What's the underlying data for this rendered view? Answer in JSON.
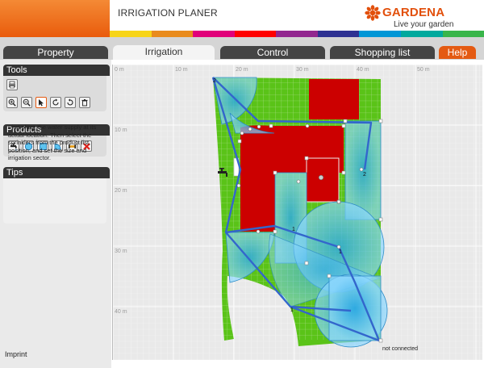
{
  "header": {
    "app_title": "IRRIGATION PLANER",
    "brand_name": "GARDENA",
    "brand_tagline": "Live your garden",
    "brand_color": "#e2500c",
    "strip_colors": [
      "#f7d417",
      "#e98b1d",
      "#e1007a",
      "#ff0000",
      "#92278f",
      "#2e3192",
      "#0096d6",
      "#00a99d",
      "#39b54a"
    ]
  },
  "tabs": [
    {
      "label": "Property",
      "active": false
    },
    {
      "label": "Irrigation",
      "active": true
    },
    {
      "label": "Control",
      "active": false
    },
    {
      "label": "Shopping list",
      "active": false
    },
    {
      "label": "Help",
      "active": false
    }
  ],
  "tools": {
    "title": "Tools",
    "items": [
      "print-icon",
      "zoom-in-icon",
      "zoom-out-icon",
      "pointer-icon",
      "rotate-left-icon",
      "rotate-right-icon",
      "trash-icon"
    ]
  },
  "products": {
    "title": "Products",
    "items": [
      "water-tap-icon",
      "circle-sprinkler-icon",
      "square-sprinkler-icon",
      "sector-sprinkler-icon",
      "pipe-connector-icon",
      "delete-icon"
    ]
  },
  "tips": {
    "title": "Tips",
    "text": "First place the water supply at its actual location. Then select the sprinklers from the product list, position, and set the size and irrigation sector."
  },
  "footer": {
    "imprint": "Imprint"
  },
  "canvas": {
    "x_ruler": [
      "0 m",
      "10 m",
      "20 m",
      "30 m",
      "40 m",
      "50 m"
    ],
    "y_ruler": [
      "10 m",
      "20 m",
      "30 m",
      "40 m"
    ],
    "status": "not connected",
    "sprinkler_labels": [
      "2",
      "2",
      "1",
      "1",
      "1"
    ],
    "colors": {
      "lawn": "#59c317",
      "building": "#cc0000",
      "water": "#66ccff",
      "pipe": "#3366cc"
    }
  }
}
